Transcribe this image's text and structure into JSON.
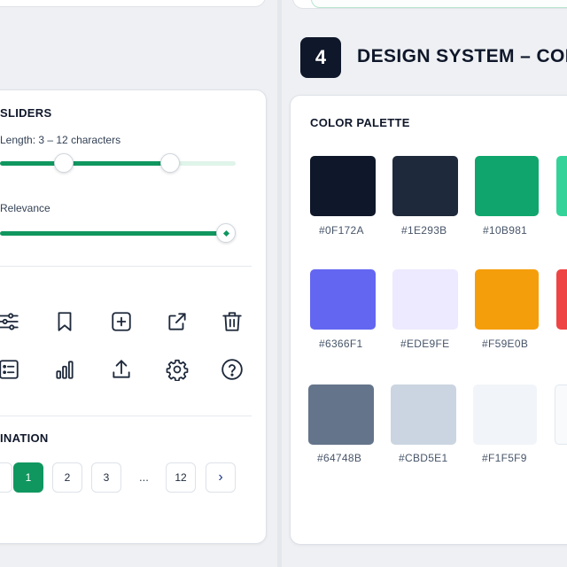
{
  "sliders": {
    "title": "SLIDERS",
    "length_label": "Length: 3 – 12 characters",
    "length_range": {
      "low": 3,
      "high": 12
    },
    "relevance_label": "Relevance",
    "relevance_value_fraction": 1.0
  },
  "icons": {
    "row1": [
      "sliders-icon",
      "bookmark-icon",
      "add-square-icon",
      "external-link-icon",
      "trash-icon"
    ],
    "row2": [
      "checklist-icon",
      "bar-chart-icon",
      "upload-icon",
      "settings-icon",
      "help-icon"
    ]
  },
  "pagination": {
    "title": "INATION",
    "pages": [
      "1",
      "2",
      "3"
    ],
    "ellipsis": "...",
    "last_page": "12",
    "next": "›",
    "active_page": "1"
  },
  "section": {
    "step_number": "4",
    "title": "DESIGN SYSTEM – COL"
  },
  "palette": {
    "title": "COLOR PALETTE",
    "colors": [
      {
        "hex": "#0F172A",
        "color": "#0f172a"
      },
      {
        "hex": "#1E293B",
        "color": "#1e293b"
      },
      {
        "hex": "#10B981",
        "color": "#10a56c"
      },
      {
        "hex": "#6366F1",
        "color": "#6366f1"
      },
      {
        "hex": "#EDE9FE",
        "color": "#ede9fe"
      },
      {
        "hex": "#F59E0B",
        "color": "#f59e0b"
      },
      {
        "hex": "#64748B",
        "color": "#64748b"
      },
      {
        "hex": "#CBD5E1",
        "color": "#cbd5e1"
      },
      {
        "hex": "#F1F5F9",
        "color": "#f1f5f9"
      }
    ],
    "clipped_colors": [
      {
        "color": "#34d399"
      },
      {
        "color": "#ef4444"
      },
      {
        "color": "#f8fafc"
      }
    ]
  }
}
